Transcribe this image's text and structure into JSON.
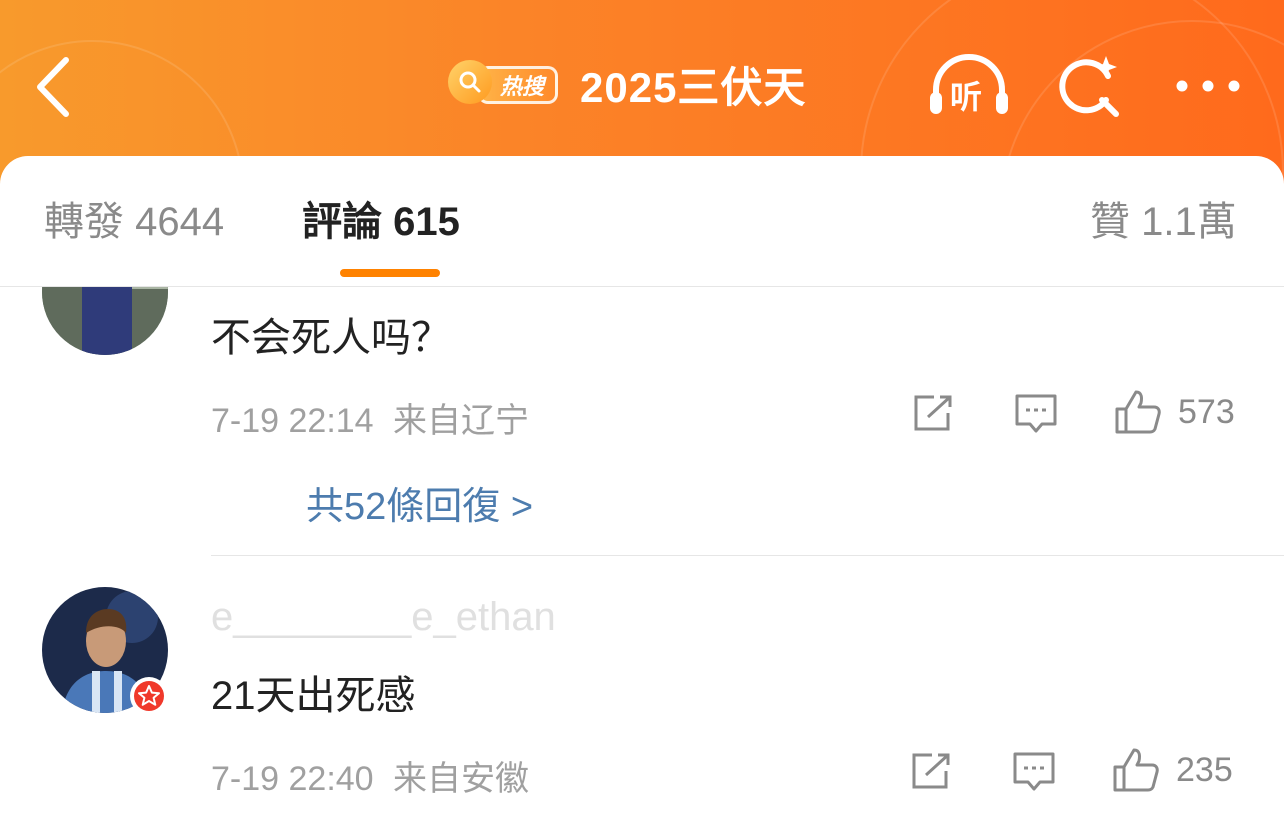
{
  "header": {
    "hot_label": "热搜",
    "title": "2025三伏天",
    "listen_label": "听"
  },
  "tabs": {
    "repost": "轉發 4644",
    "comments": "評論 615",
    "likes": "贊 1.1萬"
  },
  "comments": [
    {
      "text": "不会死人吗？",
      "time": "7-19 22:14",
      "location": "来自辽宁",
      "likes": "573",
      "replies": "共52條回復 >"
    },
    {
      "username": "e________e_ethan",
      "text": "21天出死感",
      "time": "7-19 22:40",
      "location": "来自安徽",
      "likes": "235"
    }
  ],
  "colors": {
    "header_start": "#f89a2c",
    "header_end": "#ff6a1c",
    "accent": "#ff8200",
    "link": "#4d7cae"
  }
}
